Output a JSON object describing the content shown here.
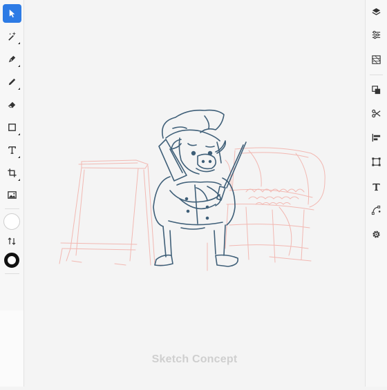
{
  "left_tools": [
    {
      "name": "select",
      "icon": "cursor-arrow-icon",
      "active": true
    },
    {
      "name": "magic",
      "icon": "magic-wand-icon"
    },
    {
      "name": "pen",
      "icon": "pen-nib-icon"
    },
    {
      "name": "pencil",
      "icon": "pencil-icon"
    },
    {
      "name": "eraser",
      "icon": "eraser-icon"
    },
    {
      "name": "shape",
      "icon": "rectangle-icon"
    },
    {
      "name": "text",
      "icon": "text-icon"
    },
    {
      "name": "crop",
      "icon": "crop-icon"
    },
    {
      "name": "image",
      "icon": "image-icon"
    }
  ],
  "colors": {
    "accent": "#2d7be5",
    "fill": "#ffffff",
    "stroke": "#111111",
    "line_art": "#3f5f78",
    "sketch": "#f2b8b2"
  },
  "right_tools": [
    {
      "name": "layers",
      "icon": "layers-icon"
    },
    {
      "name": "adjustments",
      "icon": "sliders-icon"
    },
    {
      "name": "textures",
      "icon": "texture-icon"
    },
    {
      "name": "arrange",
      "icon": "arrange-icon"
    },
    {
      "name": "scissors",
      "icon": "scissors-icon"
    },
    {
      "name": "align",
      "icon": "align-left-icon"
    },
    {
      "name": "transform",
      "icon": "transform-box-icon"
    },
    {
      "name": "type",
      "icon": "type-icon"
    },
    {
      "name": "vector-path",
      "icon": "vector-path-icon"
    },
    {
      "name": "settings",
      "icon": "gear-icon"
    }
  ],
  "canvas": {
    "caption": "Sketch Concept"
  }
}
